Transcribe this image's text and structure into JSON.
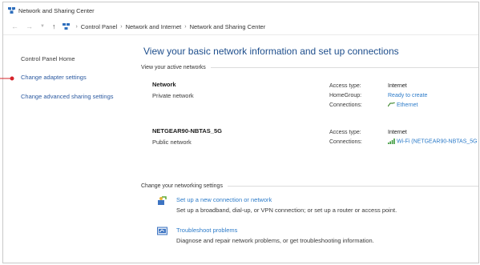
{
  "window": {
    "title": "Network and Sharing Center"
  },
  "address": {
    "breadcrumb": [
      "Control Panel",
      "Network and Internet",
      "Network and Sharing Center"
    ]
  },
  "sidebar": {
    "items": [
      {
        "label": "Control Panel Home"
      },
      {
        "label": "Change adapter settings"
      },
      {
        "label": "Change advanced sharing settings"
      }
    ]
  },
  "main": {
    "title": "View your basic network information and set up connections",
    "active_section": "View your active networks",
    "networks": [
      {
        "name": "Network",
        "type": "Private network",
        "access_type_label": "Access type:",
        "access_type": "Internet",
        "homegroup_label": "HomeGroup:",
        "homegroup": "Ready to create",
        "connections_label": "Connections:",
        "connections": "Ethernet"
      },
      {
        "name": "NETGEAR90-NBTAS_5G",
        "type": "Public network",
        "access_type_label": "Access type:",
        "access_type": "Internet",
        "connections_label": "Connections:",
        "connections": "Wi-Fi (NETGEAR90-NBTAS_5G"
      }
    ],
    "settings_section": "Change your networking settings",
    "settings": [
      {
        "label": "Set up a new connection or network",
        "description": "Set up a broadband, dial-up, or VPN connection; or set up a router or access point."
      },
      {
        "label": "Troubleshoot problems",
        "description": "Diagnose and repair network problems, or get troubleshooting information."
      }
    ]
  },
  "colors": {
    "link": "#2c7bc9",
    "title": "#1e4e8c",
    "marker": "#d6242b"
  },
  "icons": [
    "network-center-icon",
    "back-arrow-icon",
    "forward-arrow-icon",
    "up-arrow-icon",
    "ethernet-icon",
    "wifi-signal-icon",
    "new-connection-icon",
    "troubleshoot-icon"
  ]
}
